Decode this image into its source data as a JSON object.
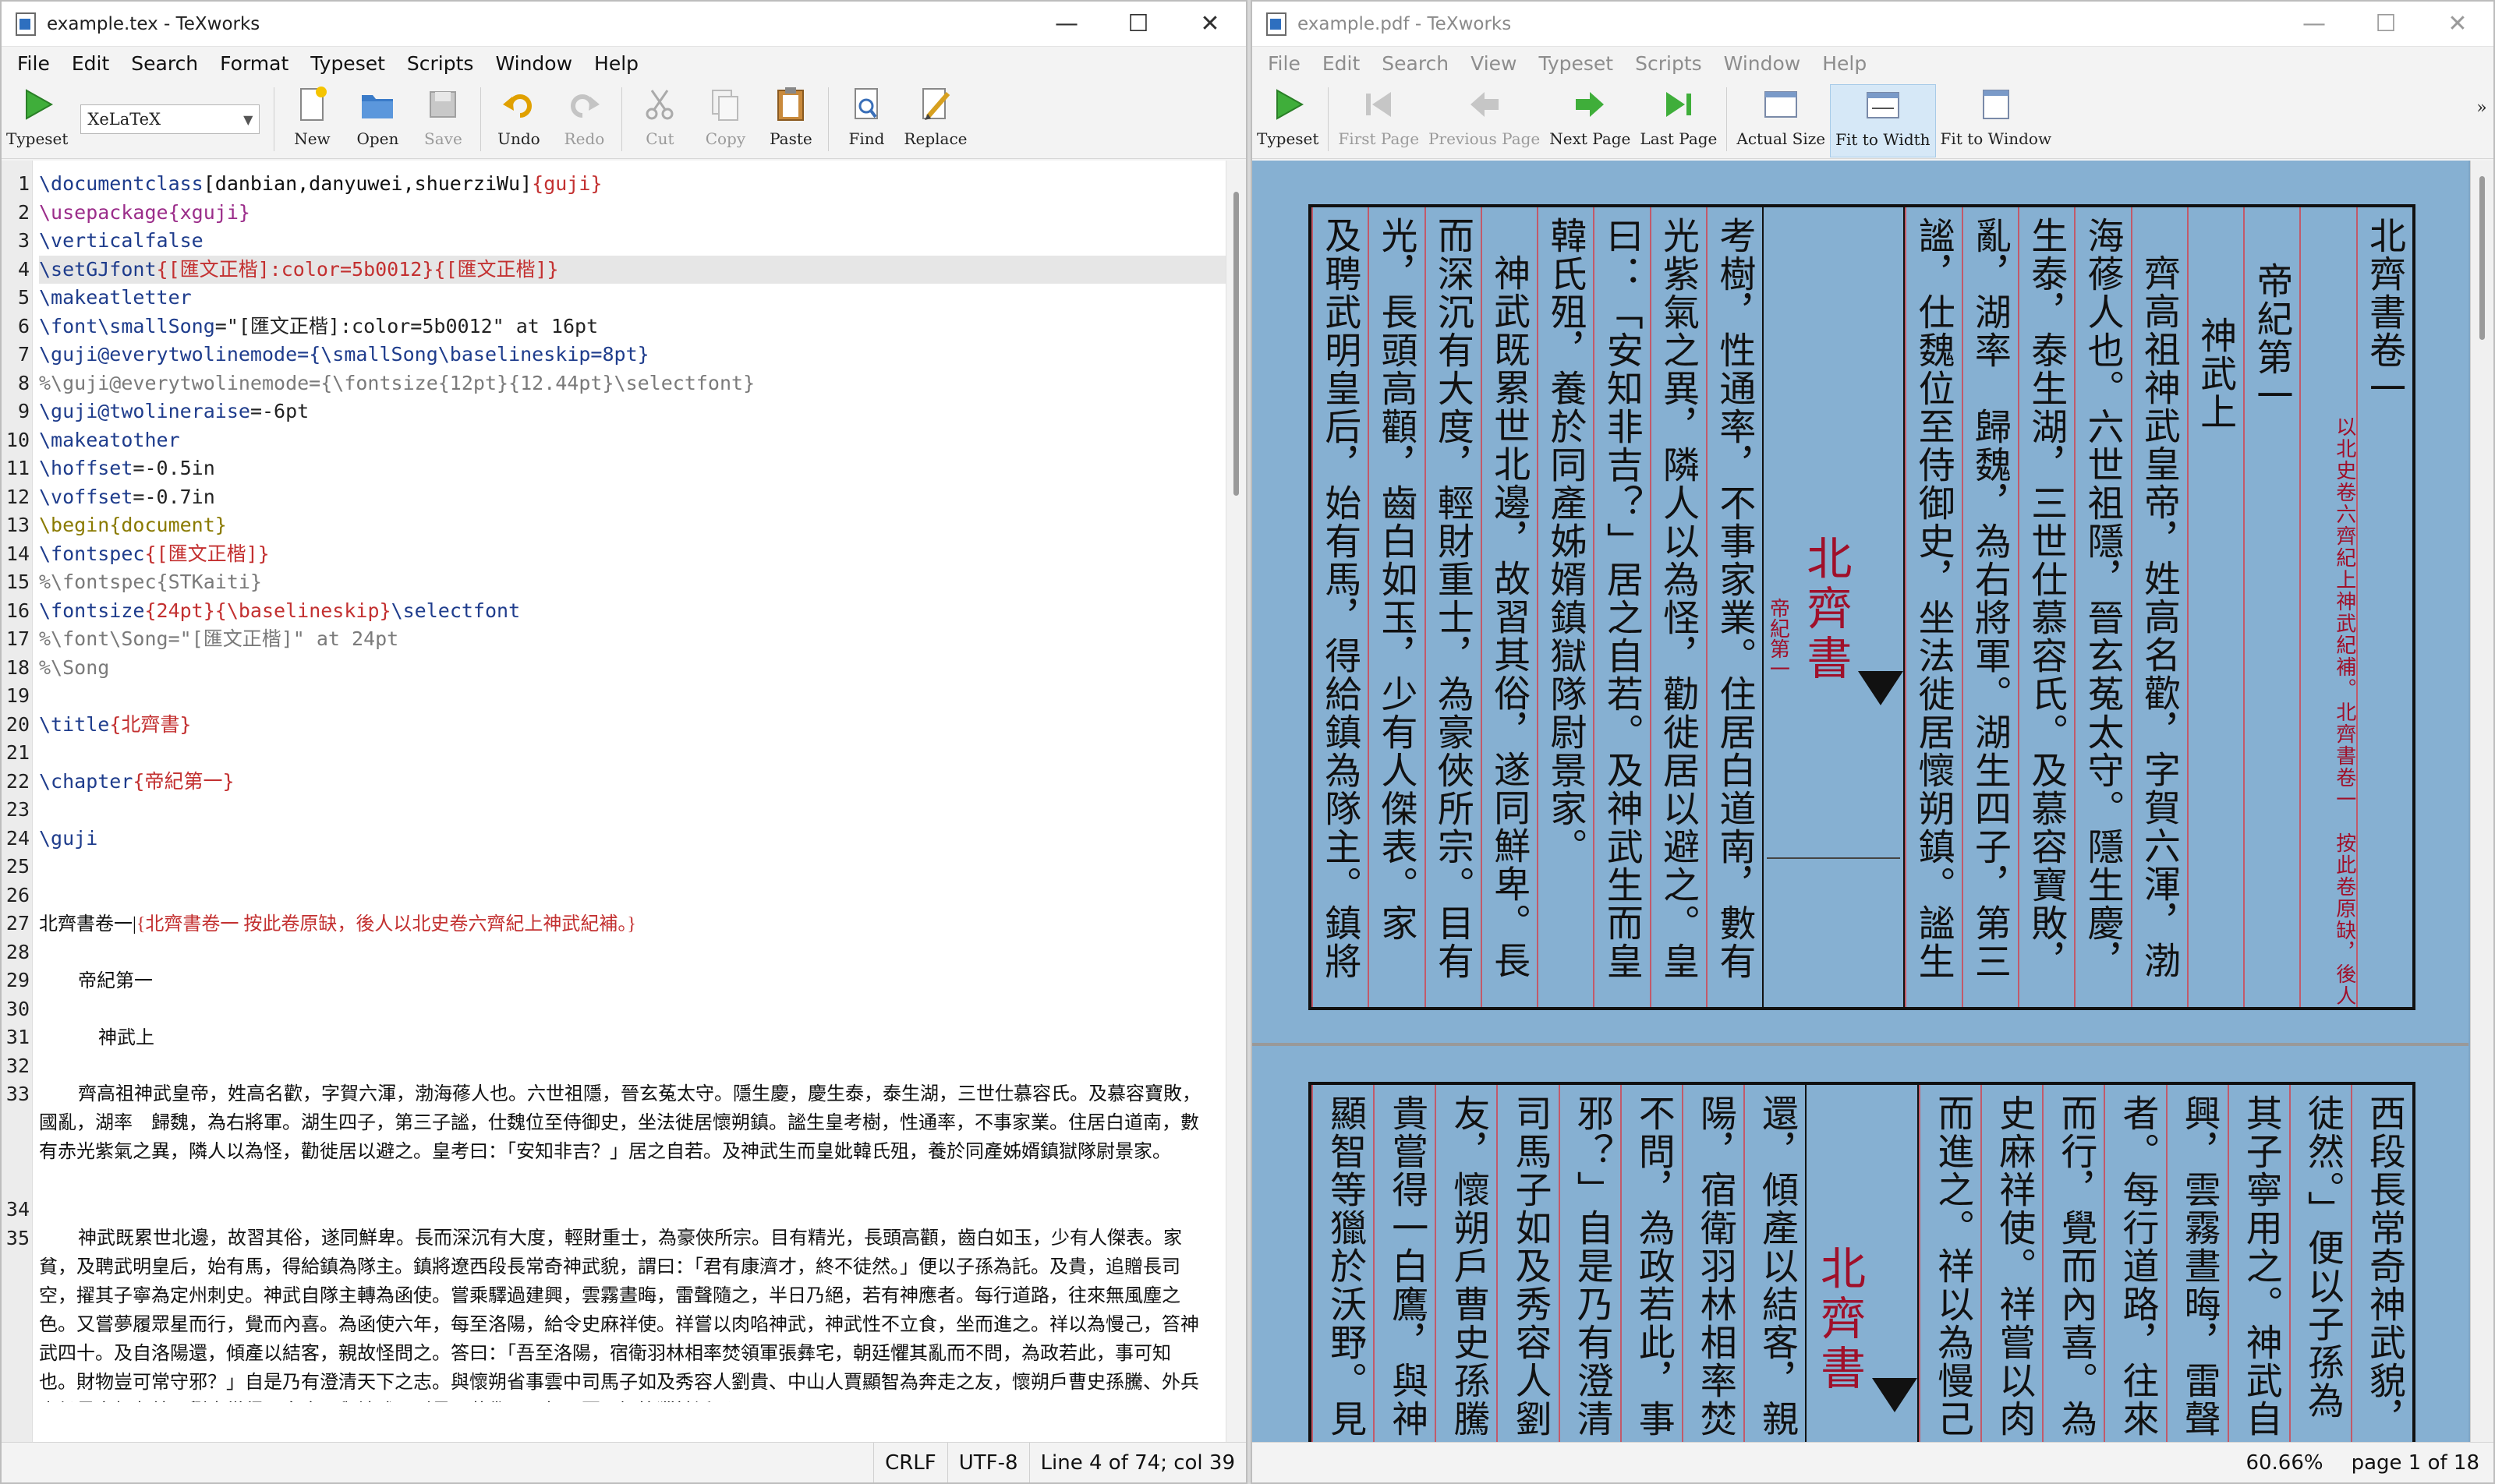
{
  "editor": {
    "title": "example.tex - TeXworks",
    "menu": [
      "File",
      "Edit",
      "Search",
      "Format",
      "Typeset",
      "Scripts",
      "Window",
      "Help"
    ],
    "toolbar": {
      "typeset": "Typeset",
      "engine": "XeLaTeX",
      "new": "New",
      "open": "Open",
      "save": "Save",
      "undo": "Undo",
      "redo": "Redo",
      "cut": "Cut",
      "copy": "Copy",
      "paste": "Paste",
      "find": "Find",
      "replace": "Replace"
    },
    "line_numbers": [
      "1",
      "2",
      "3",
      "4",
      "5",
      "6",
      "7",
      "8",
      "9",
      "10",
      "11",
      "12",
      "13",
      "14",
      "15",
      "16",
      "17",
      "18",
      "19",
      "20",
      "21",
      "22",
      "23",
      "24",
      "25",
      "26",
      "27",
      "28",
      "29",
      "30",
      "31",
      "32",
      "33",
      "34",
      "35"
    ],
    "code": {
      "l1a": "\\documentclass",
      "l1b": "[danbian,danyuwei,shuerziWu]",
      "l1c": "{guji}",
      "l2a": "\\usepackage",
      "l2b": "{xguji}",
      "l3": "\\verticalfalse",
      "l4a": "\\setGJfont",
      "l4b": "{[匯文正楷]:color=5b0012}",
      "l4c": "{[匯文正楷]}",
      "l5": "\\makeatletter",
      "l6a": "\\font\\smallSong",
      "l6b": "=\"[匯文正楷]:color=5b0012\" at 16pt",
      "l7a": "\\guji@everytwolinemode",
      "l7b": "={\\smallSong\\baselineskip=8pt}",
      "l8": "%\\guji@everytwolinemode={\\fontsize{12pt}{12.44pt}\\selectfont}",
      "l9a": "\\guji@twolineraise",
      "l9b": "=-6pt",
      "l10": "\\makeatother",
      "l11a": "\\hoffset",
      "l11b": "=-0.5in",
      "l12a": "\\voffset",
      "l12b": "=-0.7in",
      "l13a": "\\begin",
      "l13b": "{document}",
      "l14a": "\\fontspec",
      "l14b": "{[匯文正楷]}",
      "l15": "%\\fontspec{STKaiti}",
      "l16a": "\\fontsize",
      "l16b": "{24pt}",
      "l16c": "{\\baselineskip}",
      "l16d": "\\selectfont",
      "l17": "%\\font\\Song=\"[匯文正楷]\" at 24pt",
      "l18": "%\\Song",
      "l19": "",
      "l20a": "\\title",
      "l20b": "{北齊書}",
      "l21": "",
      "l22a": "\\chapter",
      "l22b": "{帝紀第一}",
      "l23": "",
      "l24": "\\guji",
      "l25": "",
      "l26": "",
      "l27a": "北齊書卷一|",
      "l27b": "{北齊書卷一  按此卷原缺，後人以北史卷六齊紀上神武紀補。}",
      "l28": "",
      "l29": "帝紀第一",
      "l30": "",
      "l31": "神武上",
      "l32": "",
      "l33": "齊高祖神武皇帝，姓高名歡，字賀六渾，渤海蓚人也。六世祖隱，晉玄菟太守。隱生慶，慶生泰，泰生湖，三世仕慕容氏。及慕容寶敗，國亂，湖率　歸魏，為右將軍。湖生四子，第三子謐，仕魏位至侍御史，坐法徙居懷朔鎮。謐生皇考樹，性通率，不事家業。住居白道南，數有赤光紫氣之異，隣人以為怪，勸徙居以避之。皇考曰：「安知非吉？」居之自若。及神武生而皇妣韓氏殂，養於同產姊婿鎮獄隊尉景家。",
      "l34": "",
      "l35": "神武既累世北邊，故習其俗，遂同鮮卑。長而深沉有大度，輕財重士，為豪俠所宗。目有精光，長頭高顴，齒白如玉，少有人傑表。家貧，及聘武明皇后，始有馬，得給鎮為隊主。鎮將遼西段長常奇神武貌，謂曰：「君有康濟才，終不徒然。」便以子孫為託。及貴，追贈長司空，擢其子寧為定州刺史。神武自隊主轉為函使。嘗乘驛過建興，雲霧晝晦，雷聲隨之，半日乃絕，若有神應者。每行道路，往來無風塵之色。又嘗夢履眾星而行，覺而內喜。為函使六年，每至洛陽，給令史麻祥使。祥嘗以肉啗神武，神武性不立食，坐而進之。祥以為慢己，笞神武四十。及自洛陽還，傾產以結客，親故怪問之。答曰：「吾至洛陽，宿衛羽林相率焚領軍張彝宅，朝廷懼其亂而不問，為政若此，事可知也。財物豈可常守邪？」自是乃有澄清天下之志。與懷朔省事雲中司馬子如及秀容人劉貴、中山人賈顯智為奔走之友，懷朔戶曹史孫騰、外兵史侯景亦相友結。劉貴嘗得一白鷹，與神武及尉景、蔡儁、子如、賈顯智等獵於沃野。"
    },
    "status": {
      "eol": "CRLF",
      "encoding": "UTF-8",
      "position": "Line 4 of 74; col 39"
    }
  },
  "pdf": {
    "title": "example.pdf - TeXworks",
    "menu": [
      "File",
      "Edit",
      "Search",
      "View",
      "Typeset",
      "Scripts",
      "Window",
      "Help"
    ],
    "toolbar": {
      "typeset": "Typeset",
      "first": "First Page",
      "previous": "Previous Page",
      "next": "Next Page",
      "last": "Last Page",
      "actual": "Actual Size",
      "fit_width": "Fit to Width",
      "fit_window": "Fit to Window",
      "more": "»"
    },
    "page1": {
      "right_cols": [
        "北齊書卷一",
        "帝紀第一",
        "神武上",
        "齊高祖神武皇帝，姓高名歡，字賀六渾，渤",
        "海蓚人也。六世祖隱，晉玄菟太守。隱生慶，慶",
        "生泰，泰生湖，三世仕慕容氏。及慕容寶敗，國",
        "亂，湖率　歸魏，為右將軍。湖生四子，第三子",
        "謐，仕魏位至侍御史，坐法徙居懷朔鎮。謐生皇"
      ],
      "note_a": "北齊書卷一　按此卷原缺，後人",
      "note_b": "以北史卷六齊紀上神武紀補。",
      "banxin_title": "北齊書",
      "banxin_chapter": "帝紀第一",
      "left_cols": [
        "考樹，性通率，不事家業。住居白道南，數有赤",
        "光紫氣之異，隣人以為怪，勸徙居以避之。皇考",
        "曰：「安知非吉？」居之自若。及神武生而皇妣",
        "韓氏殂，養於同產姊婿鎮獄隊尉景家。",
        "神武既累世北邊，故習其俗，遂同鮮卑。長",
        "而深沉有大度，輕財重士，為豪俠所宗。目有精",
        "光，長頭高顴，齒白如玉，少有人傑表。家貧，",
        "及聘武明皇后，始有馬，得給鎮為隊主。鎮將遼"
      ]
    },
    "page2": {
      "right_cols": [
        "西段長常奇神武貌，",
        "徒然。」便以子孫為",
        "其子寧用之。神武自",
        "興，雲霧晝晦，雷聲",
        "者。每行道路，往來",
        "而行，覺而內喜。為",
        "史麻祥使。祥嘗以肉",
        "而進之。祥以為慢己"
      ],
      "banxin_title": "北齊書",
      "left_cols": [
        "還，傾產以結客，親",
        "陽，宿衛羽林相率焚",
        "不問，為政若此，事",
        "邪？」自是乃有澄清",
        "司馬子如及秀容人劉",
        "友，懷朔戶曹史孫騰",
        "貴嘗得一白鷹，與神",
        "顯智等獵於沃野。見"
      ]
    },
    "status": {
      "zoom": "60.66%",
      "page": "page 1 of 18"
    }
  }
}
